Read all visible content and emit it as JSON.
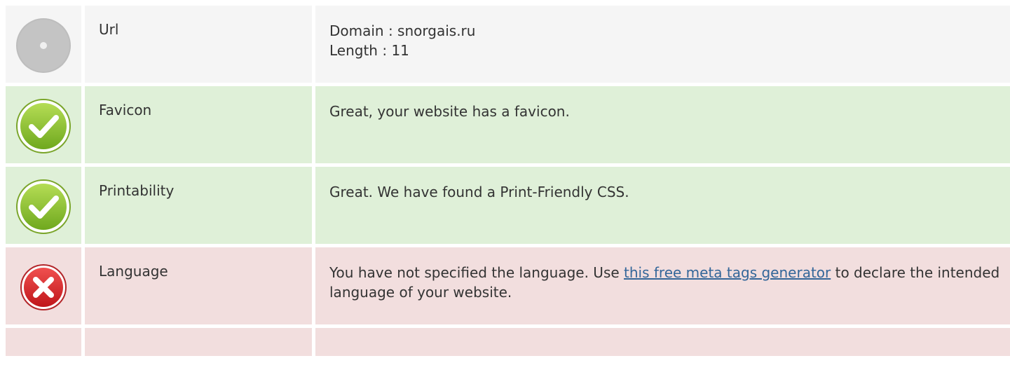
{
  "rows": [
    {
      "status": "neutral",
      "icon": "neutral-dot-icon",
      "label": "Url",
      "lines": [
        "Domain : snorgais.ru",
        "Length : 11"
      ]
    },
    {
      "status": "good",
      "icon": "checkmark-icon",
      "label": "Favicon",
      "text": "Great, your website has a favicon."
    },
    {
      "status": "good",
      "icon": "checkmark-icon",
      "label": "Printability",
      "text": "Great. We have found a Print-Friendly CSS."
    },
    {
      "status": "bad",
      "icon": "cross-icon",
      "label": "Language",
      "text_before": "You have not specified the language. Use ",
      "link_text": "this free meta tags generator",
      "text_after": " to declare the intended language of your website."
    },
    {
      "status": "bad"
    }
  ],
  "colors": {
    "neutral_bg": "#f5f5f5",
    "good_bg": "#dff0d8",
    "bad_bg": "#f2dede",
    "link": "#336699",
    "check_green": "#8cc63f",
    "cross_red": "#d9262c"
  }
}
